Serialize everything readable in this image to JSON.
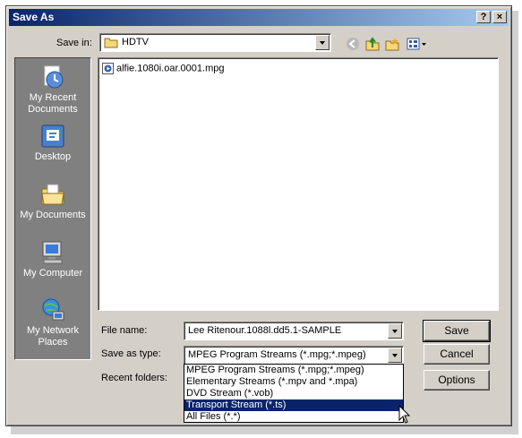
{
  "window": {
    "title": "Save As",
    "help_btn": "?",
    "close_btn": "×"
  },
  "toolbar": {
    "save_in_label": "Save in:",
    "save_in_value": "HDTV"
  },
  "places": [
    {
      "label": "My Recent Documents",
      "icon": "recent-documents-icon"
    },
    {
      "label": "Desktop",
      "icon": "desktop-icon"
    },
    {
      "label": "My Documents",
      "icon": "my-documents-icon"
    },
    {
      "label": "My Computer",
      "icon": "my-computer-icon"
    },
    {
      "label": "My Network Places",
      "icon": "network-places-icon"
    }
  ],
  "files": [
    {
      "name": "alfie.1080i.oar.0001.mpg"
    }
  ],
  "form": {
    "file_name_label": "File name:",
    "file_name_value": "Lee Ritenour.1088l.dd5.1-SAMPLE",
    "save_as_type_label": "Save as type:",
    "save_as_type_value": "MPEG Program Streams (*.mpg;*.mpeg)",
    "recent_folders_label": "Recent folders:"
  },
  "buttons": {
    "save": "Save",
    "cancel": "Cancel",
    "options": "Options"
  },
  "type_options": [
    "MPEG Program Streams (*.mpg;*.mpeg)",
    "Elementary Streams (*.mpv and *.mpa)",
    "DVD Stream (*.vob)",
    "Transport Stream (*.ts)",
    "All Files (*.*)"
  ],
  "selected_type_index": 3,
  "colors": {
    "title_start": "#0a246a",
    "title_end": "#a6caf0",
    "face": "#d4d0c8",
    "places_bg": "#808080",
    "selection": "#0a246a"
  }
}
